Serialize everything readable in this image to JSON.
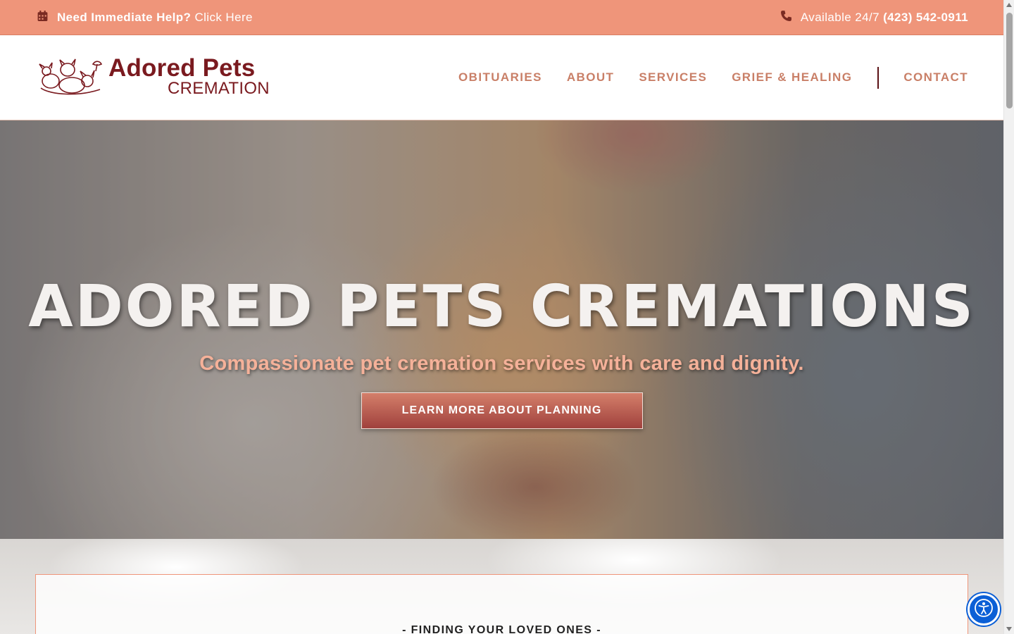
{
  "topbar": {
    "help_bold": "Need Immediate Help?",
    "help_link": "Click Here",
    "available": "Available 24/7",
    "phone": "(423) 542-0911"
  },
  "logo": {
    "title": "Adored Pets",
    "subtitle": "CREMATION"
  },
  "nav": {
    "items": [
      "OBITUARIES",
      "ABOUT",
      "SERVICES",
      "GRIEF & HEALING",
      "CONTACT"
    ]
  },
  "hero": {
    "title": "ADORED PETS CREMATIONS",
    "subtitle": "Compassionate pet cremation services with care and dignity.",
    "button": "LEARN MORE ABOUT PLANNING"
  },
  "section": {
    "heading": "- FINDING YOUR LOVED ONES -"
  },
  "colors": {
    "topbar_bg": "#ef957a",
    "brand": "#7a1a1f",
    "nav_text": "#c97f67",
    "accessibility": "#0b5fd6"
  },
  "icons": {
    "calendar": "calendar-icon",
    "phone": "phone-icon",
    "accessibility": "accessibility-icon"
  }
}
